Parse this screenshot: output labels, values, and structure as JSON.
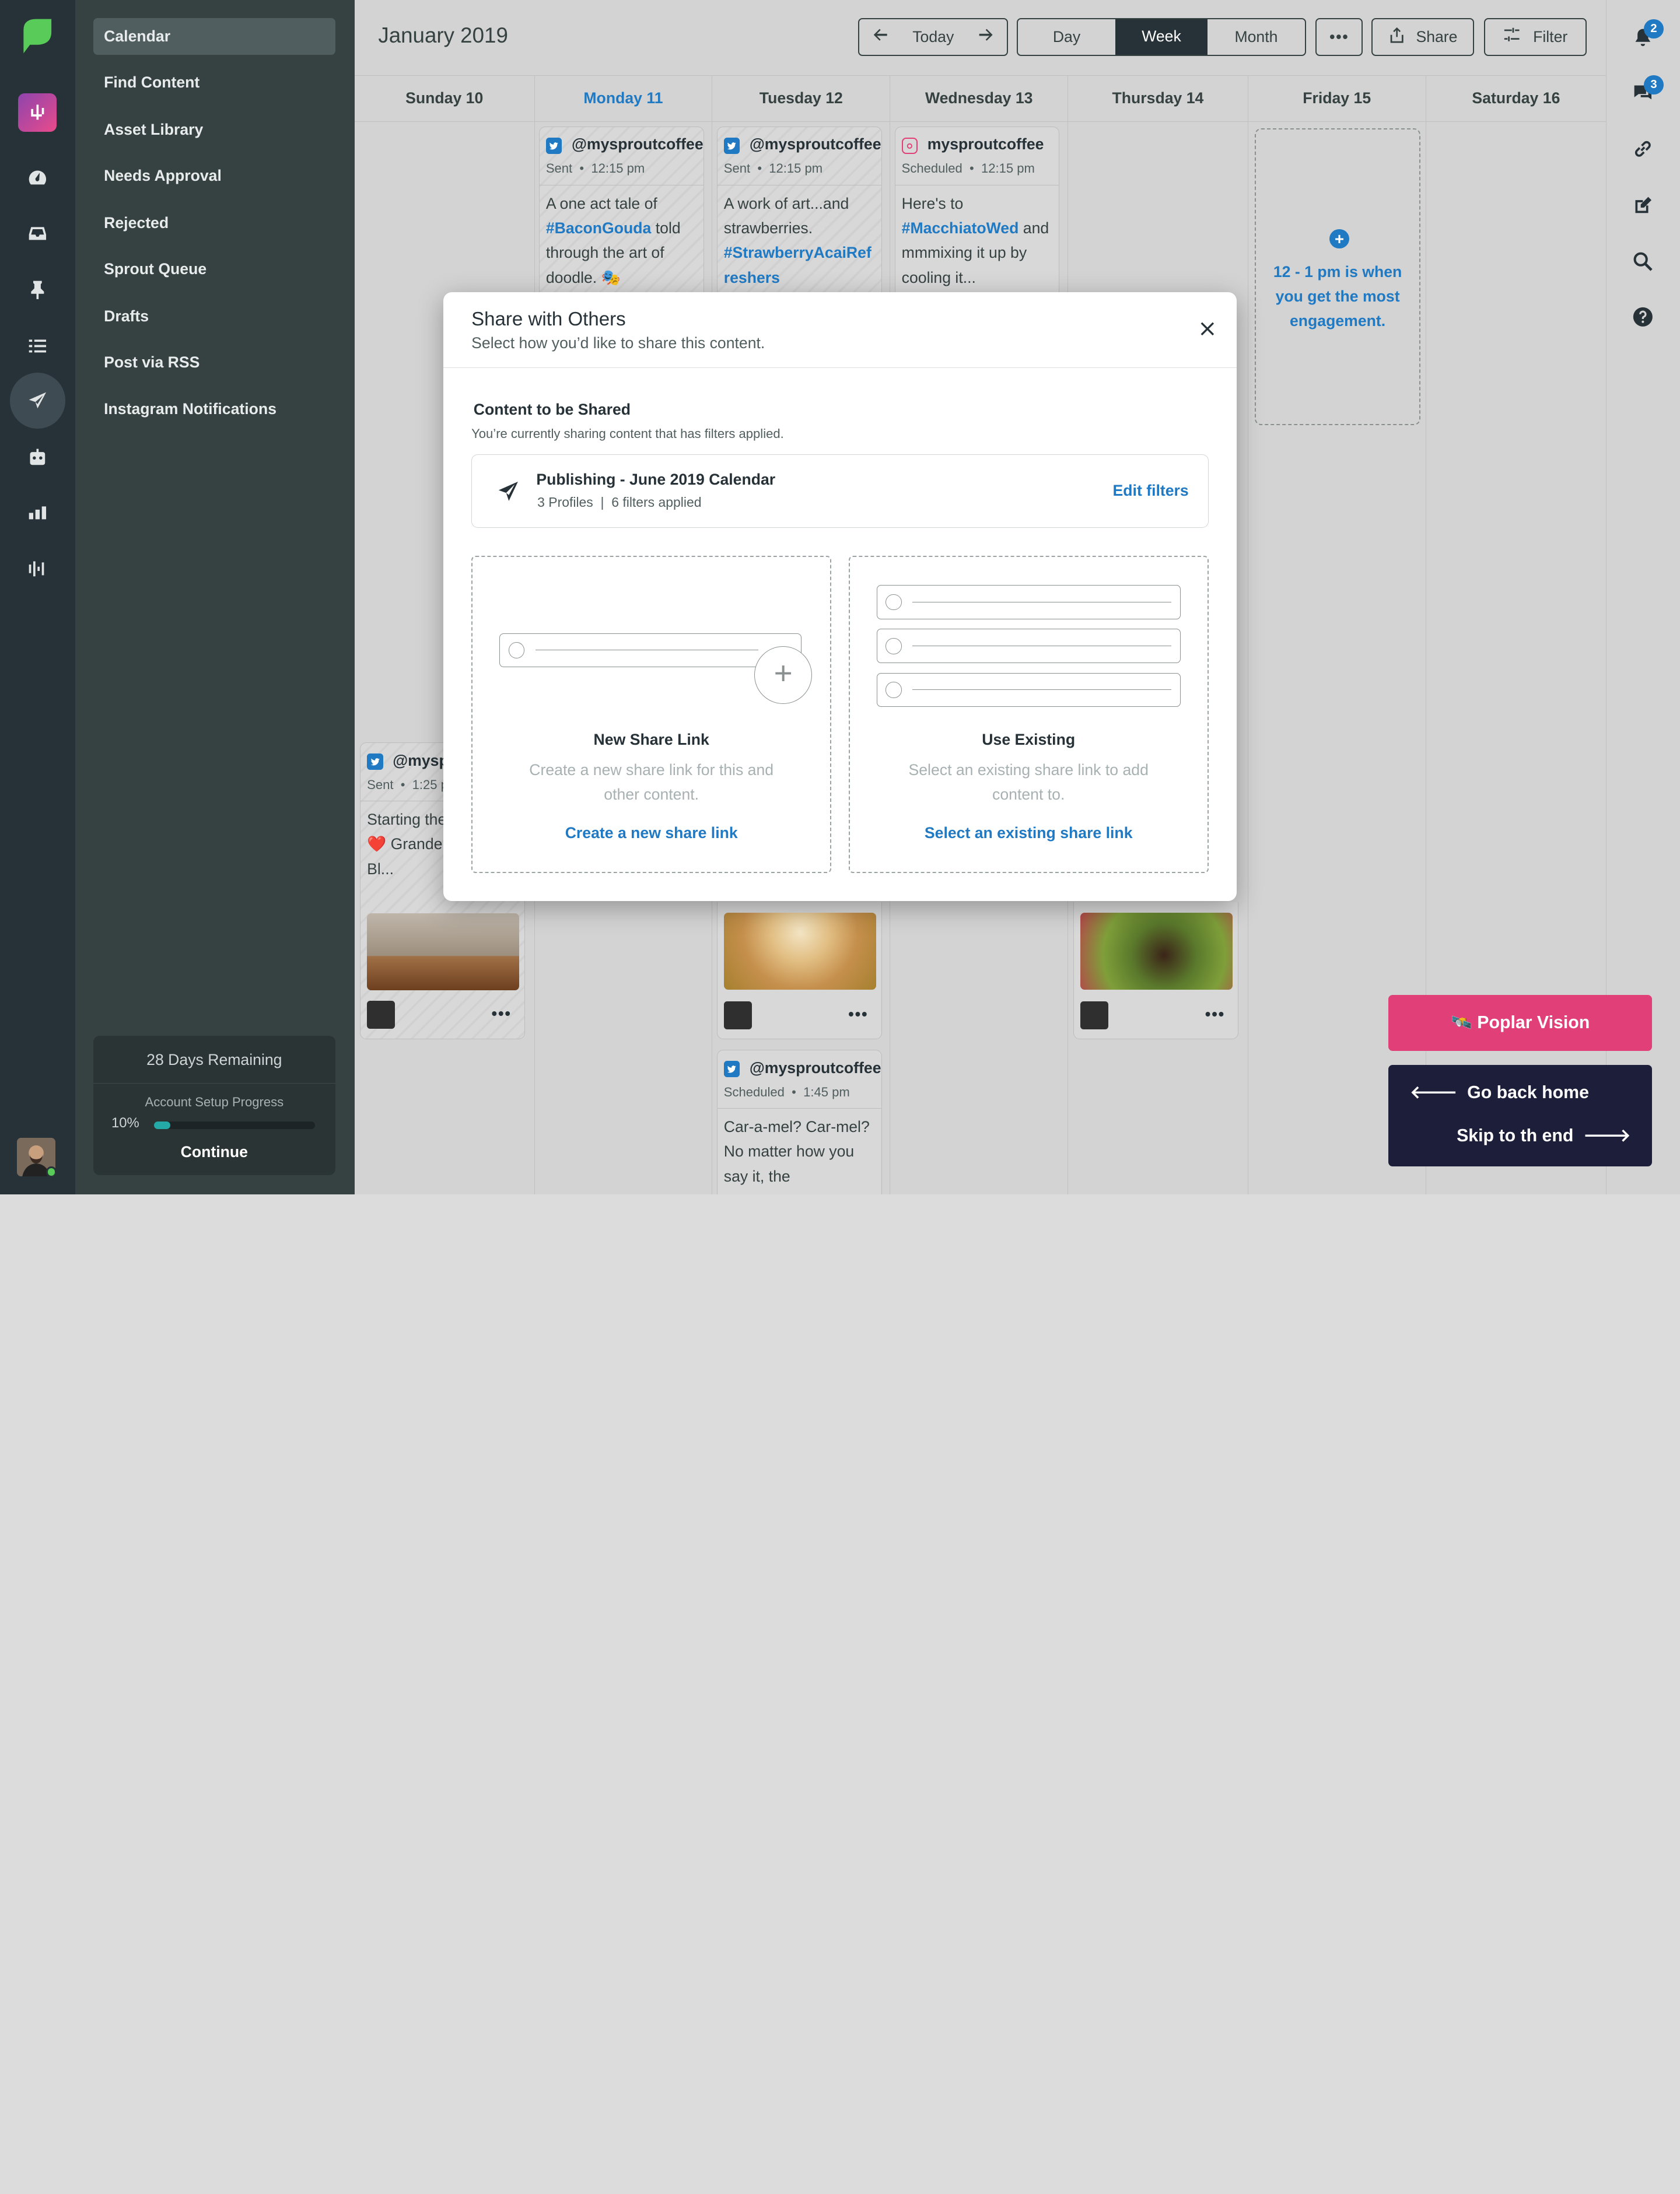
{
  "app": {
    "header_title": "January 2019",
    "toolbar": {
      "today_label": "Today",
      "views": [
        "Day",
        "Week",
        "Month"
      ],
      "active_view": "Week",
      "more_label": "•••",
      "share_label": "Share",
      "filter_label": "Filter"
    }
  },
  "rail": {
    "icons": [
      "sprout-logo-icon",
      "app-switcher-icon",
      "dashboard-icon",
      "inbox-icon",
      "pin-icon",
      "list-icon",
      "publishing-icon",
      "bot-icon",
      "reports-icon",
      "listening-icon"
    ]
  },
  "subnav": {
    "items": [
      "Calendar",
      "Find Content",
      "Asset Library",
      "Needs Approval",
      "Rejected",
      "Sprout Queue",
      "Drafts",
      "Post via RSS",
      "Instagram Notifications"
    ],
    "active_item": "Calendar",
    "trial": {
      "days_remaining": "28 Days Remaining",
      "progress_label": "Account Setup Progress",
      "progress_text": "10%",
      "progress_value": 0.1,
      "continue_label": "Continue"
    }
  },
  "calendar": {
    "days": [
      "Sunday 10",
      "Monday 11",
      "Tuesday 12",
      "Wednesday 13",
      "Thursday 14",
      "Friday 15",
      "Saturday 16"
    ],
    "today_index": 1,
    "posts": {
      "mon": {
        "account": "@mysproutcoffee",
        "status": "Sent",
        "time": "12:15 pm",
        "text_pre": "A one act tale of",
        "tag": "#BaconGouda",
        "text_post": "told through the art of doodle. 🎭"
      },
      "tue": {
        "account": "@mysproutcoffee",
        "status": "Sent",
        "time": "12:15 pm",
        "text_pre": "A work of art...and strawberries.",
        "tag": "#StrawberryAcaiRef reshers",
        "text_post": ""
      },
      "wed": {
        "account": "mysproutcoffee",
        "status": "Scheduled",
        "time": "12:15 pm",
        "text_pre": "Here's to",
        "tag": "#MacchiatoWed",
        "text_post": "and mmmixing it up by cooling it..."
      },
      "sun": {
        "account": "@mysp",
        "status": "Sent",
        "time": "1:25 p",
        "text": "Starting the bright. ❤️❤️ Grande Ice Coffee Bl..."
      },
      "tue2": {
        "account": "@mysproutcoffee",
        "status": "Scheduled",
        "time": "1:45 pm",
        "text": "Car-a-mel? Car-mel? No matter how you say it, the"
      }
    },
    "engagement_tip": "12 - 1 pm is when you get the most engagement."
  },
  "right_rail": {
    "notifications_badge": "2",
    "messages_badge": "3",
    "icons": [
      "bell-icon",
      "chat-icon",
      "link-icon",
      "compose-icon",
      "search-icon",
      "help-icon"
    ]
  },
  "modal": {
    "title": "Share with Others",
    "subtitle": "Select how you’d like to share this content.",
    "content_heading": "Content to be Shared",
    "content_note": "You’re currently sharing content that has filters applied.",
    "content_name": "Publishing - June 2019 Calendar",
    "content_meta": "3 Profiles  |  6 filters applied",
    "edit_filters_label": "Edit filters",
    "new_link": {
      "title": "New Share Link",
      "desc": "Create a new share link for this and other content.",
      "action": "Create a new share link"
    },
    "existing_link": {
      "title": "Use Existing",
      "desc": "Select an existing share link to add content to.",
      "action": "Select an existing share link"
    }
  },
  "overlay": {
    "poplar_label": "Poplar Vision",
    "poplar_emoji": "🛰️",
    "go_home_label": "Go back home",
    "skip_label": "Skip to th end"
  },
  "colors": {
    "brand_green": "#59cb59",
    "link_blue": "#2079c3",
    "poplar_pink": "#e04077",
    "nav_dark": "#263238"
  }
}
